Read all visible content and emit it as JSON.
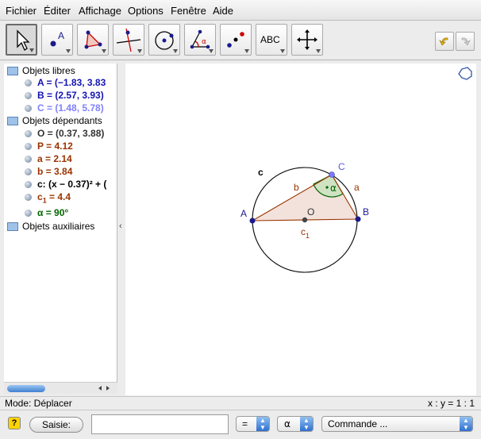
{
  "menu": {
    "items": [
      "Fichier",
      "Éditer",
      "Affichage",
      "Options",
      "Fenêtre",
      "Aide"
    ]
  },
  "toolbar": {
    "tools": [
      {
        "icon": "pointer-arrow-icon",
        "active": true
      },
      {
        "icon": "point-icon",
        "label": "A"
      },
      {
        "icon": "polygon-icon"
      },
      {
        "icon": "perpendicular-line-icon"
      },
      {
        "icon": "circle-center-point-icon"
      },
      {
        "icon": "angle-icon",
        "label": "α"
      },
      {
        "icon": "reflect-point-icon"
      },
      {
        "icon": "text-icon",
        "label": "ABC"
      },
      {
        "icon": "move-view-icon"
      }
    ],
    "undo_icon": "undo-icon",
    "redo_icon": "redo-icon"
  },
  "algebra": {
    "sections": [
      {
        "title": "Objets libres",
        "items": [
          {
            "text": "A = (−1.83, 3.83",
            "color": "#1414b4"
          },
          {
            "text": "B = (2.57, 3.93)",
            "color": "#1414b4"
          },
          {
            "text": "C = (1.48, 5.78)",
            "color": "#8080ff"
          }
        ]
      },
      {
        "title": "Objets dépendants",
        "items": [
          {
            "text": "O = (0.37, 3.88)",
            "color": "#333333"
          },
          {
            "text": "P = 4.12",
            "color": "#993300"
          },
          {
            "text": "a = 2.14",
            "color": "#993300"
          },
          {
            "text": "b = 3.84",
            "color": "#993300"
          },
          {
            "text": "c: (x − 0.37)² + (",
            "color": "#000000"
          },
          {
            "text_base": "c",
            "text_sub": "1",
            "text_rest": " = 4.4",
            "color": "#993300"
          },
          {
            "text": "α = 90°",
            "color": "#006400"
          }
        ]
      },
      {
        "title": "Objets auxiliaires",
        "items": []
      }
    ],
    "collapse_arrow": "‹"
  },
  "graphics": {
    "labels": {
      "A": "A",
      "B": "B",
      "C": "C",
      "O": "O",
      "a": "a",
      "b": "b",
      "c": "c",
      "c1_base": "c",
      "c1_sub": "1",
      "alpha": "α"
    },
    "colors": {
      "point": "#1a1a8c",
      "point_C": "#7a7aff",
      "segment": "#993300",
      "circle": "#000000",
      "angle": "#006400",
      "triangle_fill": "#f3e2dc"
    },
    "view_icon": "graphics-view-options-icon"
  },
  "status": {
    "mode": "Mode: Déplacer",
    "scale": "x : y = 1 : 1"
  },
  "input": {
    "help_icon": "help-icon",
    "saisie_label": "Saisie:",
    "value": "",
    "placeholder": "",
    "symbol_select": "=",
    "greek_select": "α",
    "command_select": "Commande ..."
  }
}
